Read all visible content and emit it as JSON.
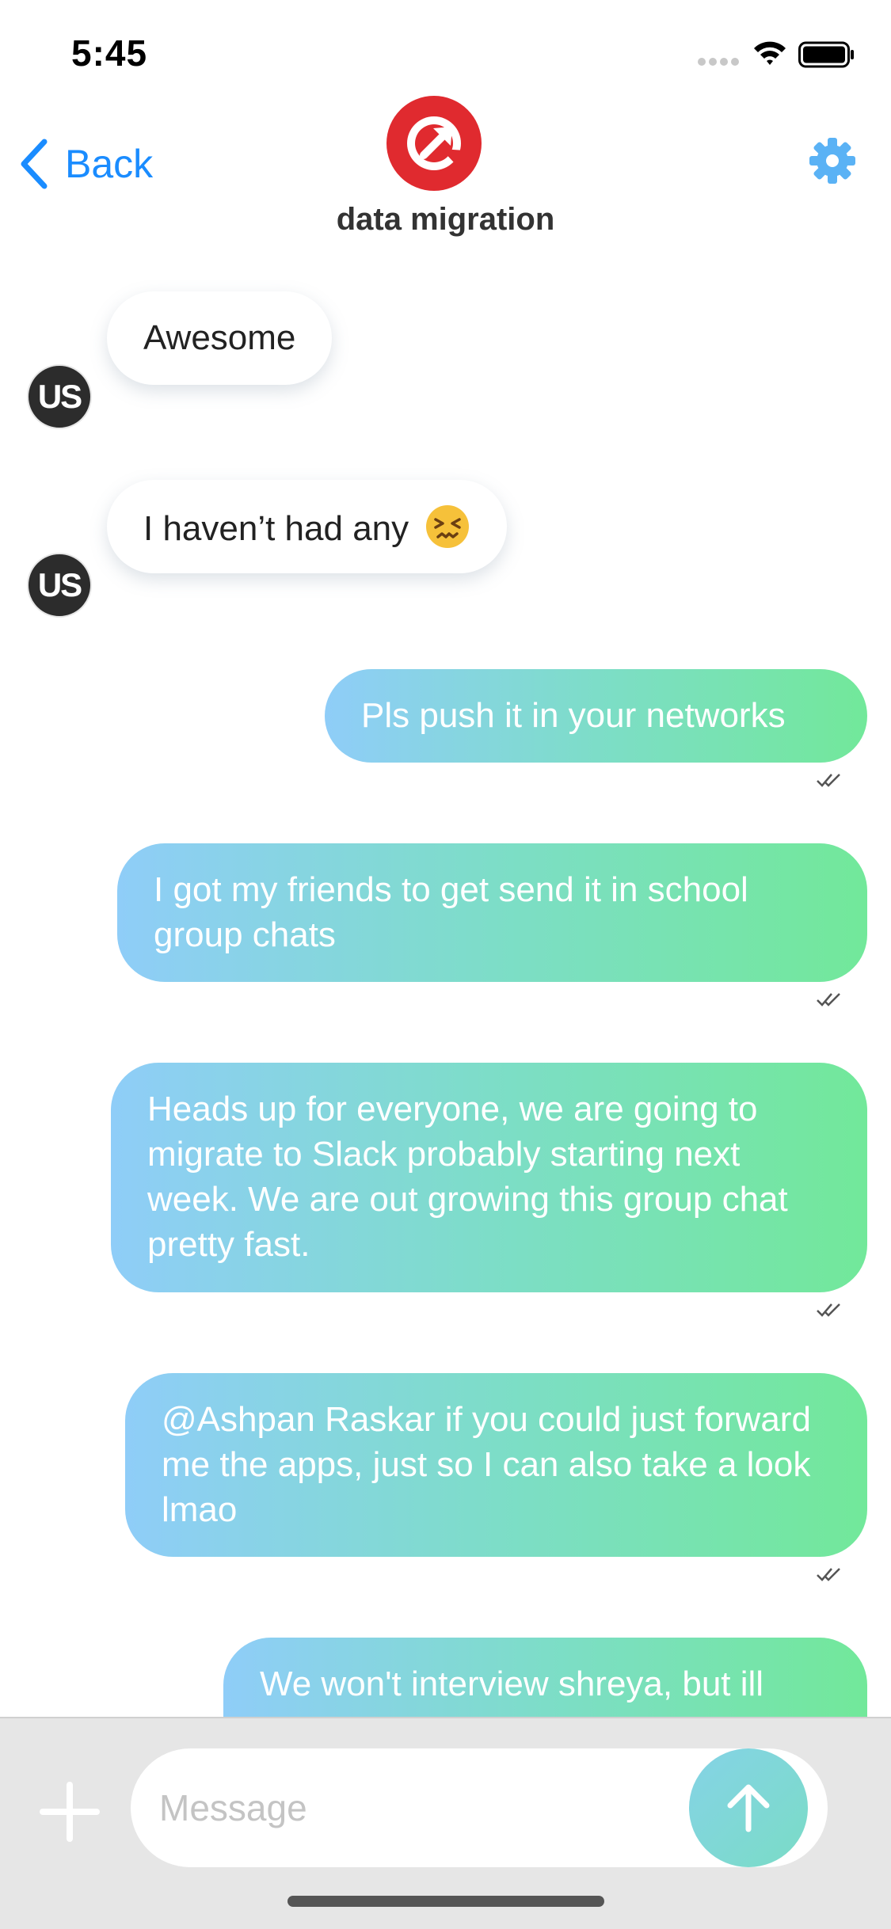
{
  "status_bar": {
    "time": "5:45"
  },
  "nav": {
    "back_label": "Back",
    "title": "data migration",
    "accent_color": "#1a8cff",
    "avatar_icon": "red-circle-arrow-logo",
    "settings_icon": "gear-icon"
  },
  "messages": [
    {
      "direction": "incoming",
      "text": "Awesome",
      "avatar_initials": "US"
    },
    {
      "direction": "incoming",
      "text": "I haven’t had any",
      "emoji": "confounded-face",
      "avatar_initials": "US"
    },
    {
      "direction": "outgoing",
      "text": "Pls push it in your networks",
      "read": true
    },
    {
      "direction": "outgoing",
      "text": "I got my friends to get send it in school group chats",
      "read": true
    },
    {
      "direction": "outgoing",
      "text": "Heads up for everyone, we are going to migrate to Slack probably starting next week. We are out growing this group chat pretty fast.",
      "read": true
    },
    {
      "direction": "outgoing",
      "text": "@Ashpan Raskar if you could just forward me the apps, just so I can also take a look lmao",
      "read": true
    },
    {
      "direction": "outgoing",
      "text": "We won't interview shreya, but ill",
      "read": false
    }
  ],
  "composer": {
    "placeholder": "Message",
    "value": ""
  },
  "colors": {
    "outgoing_gradient_start": "#8fcdf8",
    "outgoing_gradient_end": "#72e89a",
    "composer_background": "#e6e6e6"
  }
}
